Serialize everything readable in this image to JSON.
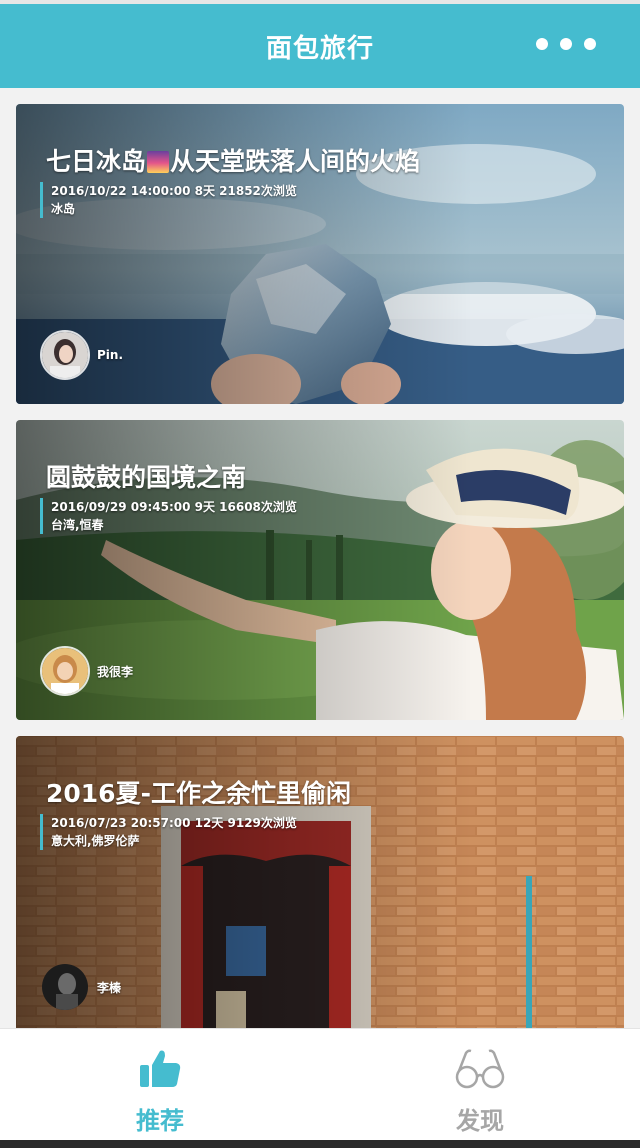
{
  "header": {
    "title": "面包旅行",
    "more_icon": "more-dots-icon"
  },
  "colors": {
    "accent": "#45bccf",
    "inactive": "#a6a6a6"
  },
  "cards": [
    {
      "title_before": "七日冰岛",
      "title_emoji": "sunrise-emoji-icon",
      "title_after": "从天堂跌落人间的火焰",
      "meta": "2016/10/22 14:00:00 8天 21852次浏览",
      "location": "冰岛",
      "author": "Pin."
    },
    {
      "title": "圆鼓鼓的国境之南",
      "meta": "2016/09/29 09:45:00 9天 16608次浏览",
      "location": "台湾,恒春",
      "author": "我很李"
    },
    {
      "title": "2016夏-工作之余忙里偷闲",
      "meta": "2016/07/23 20:57:00 12天 9129次浏览",
      "location": "意大利,佛罗伦萨",
      "author": "李榛"
    }
  ],
  "tabs": [
    {
      "label": "推荐",
      "icon": "thumbs-up-icon",
      "active": true
    },
    {
      "label": "发现",
      "icon": "glasses-icon",
      "active": false
    }
  ]
}
